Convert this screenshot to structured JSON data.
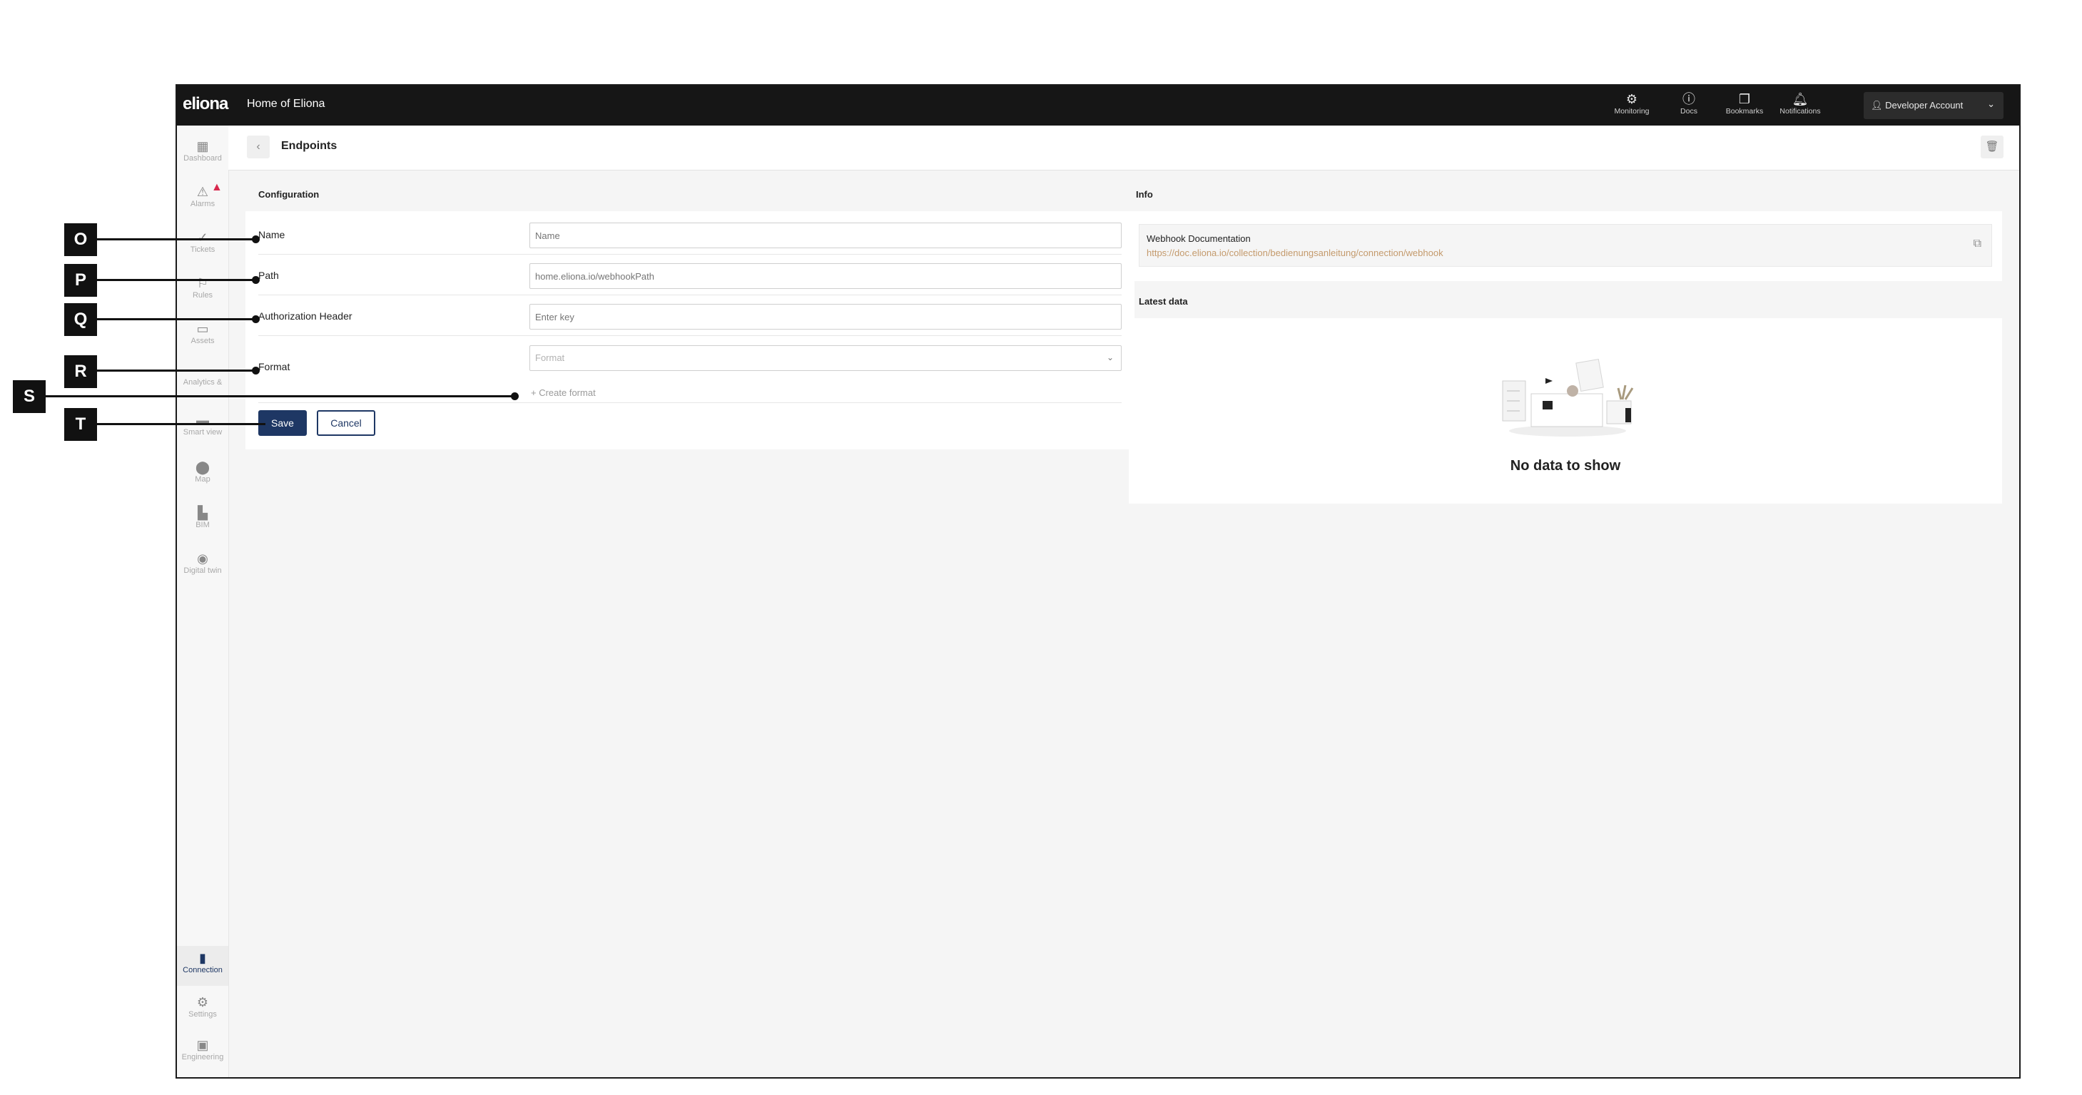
{
  "topbar": {
    "logo": "eliona",
    "title": "Home of Eliona",
    "items": [
      {
        "label": "Monitoring",
        "icon": "monitoring-icon"
      },
      {
        "label": "Docs",
        "icon": "info-icon"
      },
      {
        "label": "Bookmarks",
        "icon": "bookmark-icon"
      },
      {
        "label": "Notifications",
        "icon": "bell-icon"
      }
    ],
    "account": "Developer Account"
  },
  "sidebar": {
    "items": [
      {
        "label": "Dashboard",
        "icon": "dashboard-icon"
      },
      {
        "label": "Alarms",
        "icon": "alarm-icon"
      },
      {
        "label": "Tickets",
        "icon": "ticket-icon"
      },
      {
        "label": "Rules",
        "icon": "rules-icon"
      },
      {
        "label": "Assets",
        "icon": "assets-icon"
      },
      {
        "label": "Analytics &",
        "icon": "analytics-icon"
      },
      {
        "label": "Smart view",
        "icon": "smart-view-icon"
      },
      {
        "label": "Map",
        "icon": "map-pin-icon"
      },
      {
        "label": "BIM",
        "icon": "bim-icon"
      },
      {
        "label": "Digital twin",
        "icon": "digital-twin-icon"
      },
      {
        "label": "Connection",
        "icon": "connection-icon"
      },
      {
        "label": "Settings",
        "icon": "gear-icon"
      },
      {
        "label": "Engineering",
        "icon": "engineering-icon"
      }
    ],
    "active": "Connection"
  },
  "header": {
    "title": "Endpoints"
  },
  "configuration": {
    "title": "Configuration",
    "fields": {
      "name": {
        "label": "Name",
        "placeholder": "Name",
        "value": ""
      },
      "path": {
        "label": "Path",
        "placeholder": "home.eliona.io/webhookPath",
        "value": ""
      },
      "auth": {
        "label": "Authorization Header",
        "placeholder": "Enter key",
        "value": ""
      },
      "format": {
        "label": "Format",
        "placeholder": "Format",
        "value": ""
      }
    },
    "create_format": "+  Create format",
    "save": "Save",
    "cancel": "Cancel"
  },
  "info": {
    "title": "Info",
    "doc_title": "Webhook Documentation",
    "doc_url": "https://doc.eliona.io/collection/bedienungsanleitung/connection/webhook"
  },
  "latest": {
    "title": "Latest data",
    "empty": "No data to show"
  },
  "callouts": [
    "O",
    "P",
    "Q",
    "R",
    "S",
    "T"
  ]
}
